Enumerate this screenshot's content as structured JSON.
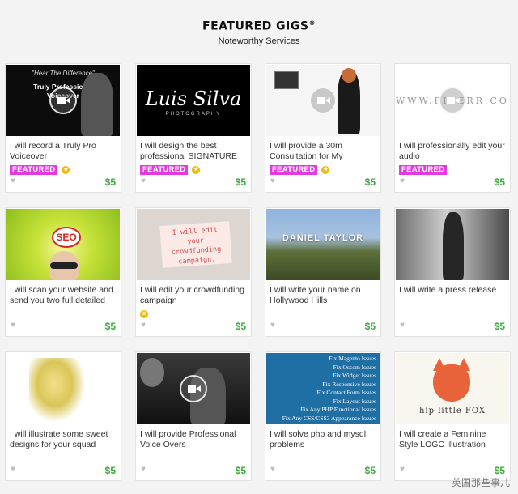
{
  "header": {
    "title": "FEATURED GIGS",
    "title_mark": "®",
    "subtitle": "Noteworthy Services"
  },
  "colors": {
    "featured": "#e23adf",
    "price": "#3ca93c",
    "gold": "#f5b800"
  },
  "cards": [
    {
      "title": "I will record a Truly Pro Voiceover",
      "featured": "FEATURED",
      "price": "$5",
      "thumb_text": [
        "\"Hear The Difference\"",
        "Truly Professional",
        "Voiceover"
      ]
    },
    {
      "title": "I will design the best professional SIGNATURE",
      "featured": "FEATURED",
      "price": "$5",
      "thumb_text": [
        "Luis Silva",
        "PHOTOGRAPHY"
      ]
    },
    {
      "title": "I will provide a 30m Consultation for My",
      "featured": "FEATURED",
      "price": "$5"
    },
    {
      "title": "I will professionally edit your audio",
      "featured": "FEATURED",
      "price": "$5",
      "thumb_text": [
        "WWW.FIVERR.COM"
      ]
    },
    {
      "title": "I will scan your website and send you two full detailed",
      "price": "$5",
      "thumb_text": [
        "SEO"
      ]
    },
    {
      "title": "I will edit your crowdfunding campaign",
      "price": "$5",
      "thumb_text": [
        "I will edit your crowdfunding campaign."
      ]
    },
    {
      "title": "I will write your name on Hollywood Hills",
      "price": "$5",
      "thumb_text": [
        "DANIEL TAYLOR"
      ]
    },
    {
      "title": "I will write a press release",
      "price": "$5"
    },
    {
      "title": "I will illustrate some sweet designs for your squad",
      "price": "$5"
    },
    {
      "title": "I will provide Professional Voice Overs",
      "price": "$5"
    },
    {
      "title": "I will solve php and mysql problems",
      "price": "$5",
      "thumb_text": [
        "Fix Magento Issues",
        "Fix Oscom Issues",
        "Fix Widget Issues",
        "Fix Responsive Issues",
        "Fix Contact Form Issues",
        "Fix Layout Issues",
        "Fix Any PHP Functional Issues",
        "Fix Any CSS/CSS3 Appearance Issues"
      ]
    },
    {
      "title": "I will create a Feminine Style LOGO illustration",
      "price": "$5",
      "thumb_text": [
        "hip little FOX"
      ]
    }
  ],
  "watermark": "英国那些事儿"
}
